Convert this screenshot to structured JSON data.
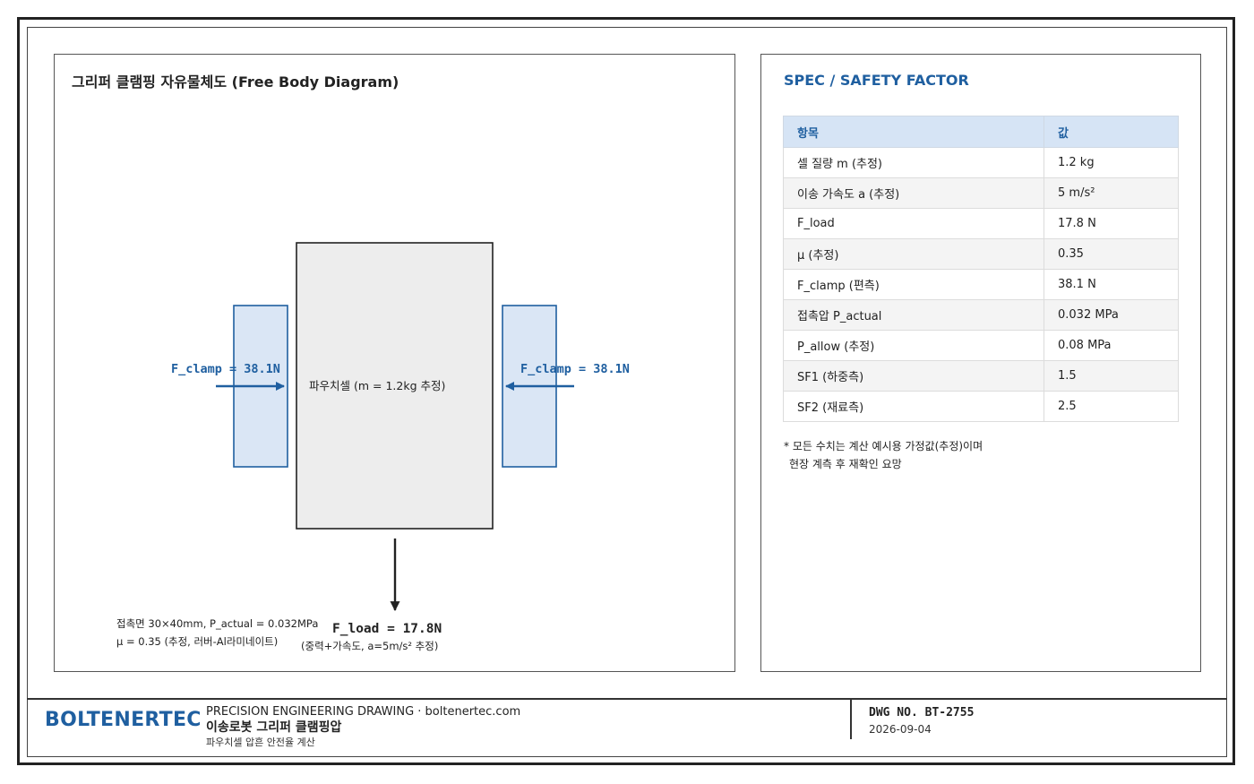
{
  "diagram": {
    "title": "그리퍼 클램핑 자유물체도 (Free Body Diagram)",
    "cell_label": "파우치셀 (m = 1.2kg 추정)",
    "clamp_left_label": "F_clamp = 38.1N",
    "clamp_right_label": "F_clamp = 38.1N",
    "load_label": "F_load = 17.8N",
    "load_sub": "(중력+가속도, a=5m/s² 추정)",
    "contact_line1": "접촉면 30×40mm, P_actual = 0.032MPa",
    "contact_line2": "μ = 0.35 (추정, 러버-Al라미네이트)",
    "colors": {
      "accent": "#1f5fa0",
      "pad_fill": "#dae6f5",
      "cell_fill": "#ededed"
    }
  },
  "spec": {
    "title": "SPEC / SAFETY FACTOR",
    "headers": [
      "항목",
      "값"
    ],
    "rows": [
      [
        "셀 질량 m (추정)",
        "1.2 kg"
      ],
      [
        "이송 가속도 a (추정)",
        "5 m/s²"
      ],
      [
        "F_load",
        "17.8 N"
      ],
      [
        "μ (추정)",
        "0.35"
      ],
      [
        "F_clamp (편측)",
        "38.1 N"
      ],
      [
        "접촉압 P_actual",
        "0.032 MPa"
      ],
      [
        "P_allow (추정)",
        "0.08 MPa"
      ],
      [
        "SF1 (하중측)",
        "1.5"
      ],
      [
        "SF2 (재료측)",
        "2.5"
      ]
    ],
    "note_line1": "* 모든 수치는 계산 예시용 가정값(추정)이며",
    "note_line2": "현장 계측 후 재확인 요망"
  },
  "titleblock": {
    "brand": "BOLTENERTEC",
    "line1": "PRECISION ENGINEERING DRAWING · boltenertec.com",
    "line2": "이송로봇 그리퍼 클램핑압",
    "line3": "파우치셀 압흔 안전율 계산",
    "dwg_no": "DWG NO. BT-2755",
    "date": "2026-09-04"
  }
}
